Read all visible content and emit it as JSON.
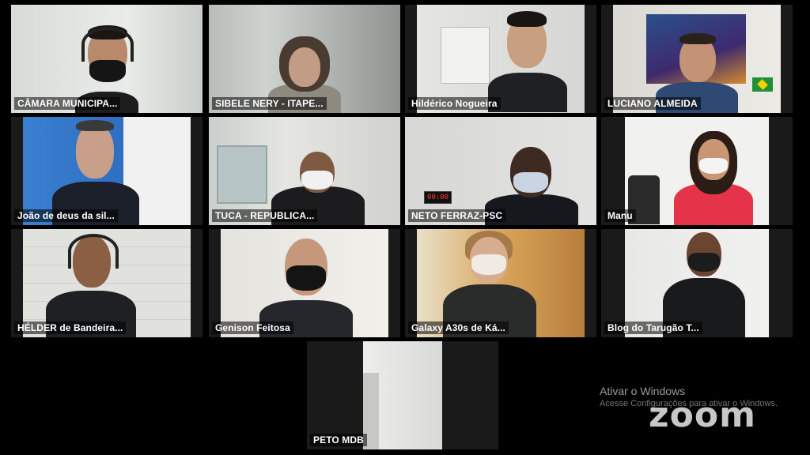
{
  "participants": [
    {
      "name": "CÂMARA MUNICIPA..."
    },
    {
      "name": "SIBELE NERY - ITAPE..."
    },
    {
      "name": "Hildérico Nogueira"
    },
    {
      "name": "LUCIANO ALMEIDA"
    },
    {
      "name": "João de deus da sil..."
    },
    {
      "name": "TUCA - REPUBLICA..."
    },
    {
      "name": "NETO FERRAZ-PSC"
    },
    {
      "name": "Manu"
    },
    {
      "name": "HÉLDER de Bandeira..."
    },
    {
      "name": "Genison Feitosa"
    },
    {
      "name": "Galaxy A30s de Ká..."
    },
    {
      "name": "Blog do Tarugão T..."
    },
    {
      "name": "PETO MDB"
    }
  ],
  "timer_display": "00:00",
  "watermark": {
    "title": "Ativar o Windows",
    "subtitle": "Acesse Configurações para ativar o Windows."
  },
  "logo": "zoom",
  "colors": {
    "active_speaker_border": "#5fd35b",
    "background": "#000000"
  }
}
